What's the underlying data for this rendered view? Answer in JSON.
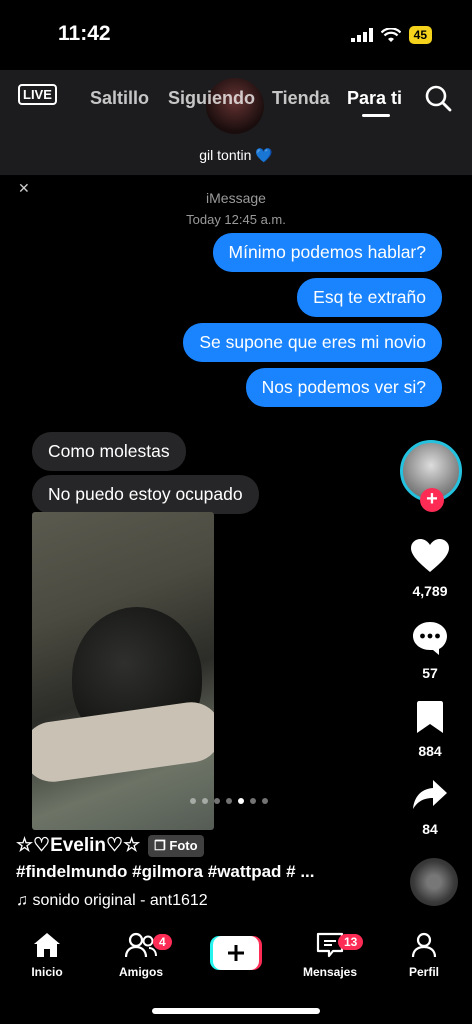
{
  "status": {
    "time": "11:42",
    "battery": "45"
  },
  "top_nav": {
    "live_label": "LIVE",
    "tabs": [
      {
        "label": "Saltillo"
      },
      {
        "label": "Siguiendo"
      },
      {
        "label": "Tienda"
      },
      {
        "label": "Para ti"
      }
    ]
  },
  "imessage": {
    "contact_name": "gil tontin 💙",
    "service_label": "iMessage",
    "timestamp": "Today 12:45 a.m.",
    "outgoing": [
      "Mínimo podemos hablar?",
      "Esq te extraño",
      "Se supone que eres mi novio",
      "Nos podemos ver si?"
    ],
    "incoming": [
      "Como molestas",
      "No puedo estoy ocupado"
    ]
  },
  "carousel": {
    "total": 7,
    "active_index": 5
  },
  "actions": {
    "likes": "4,789",
    "comments": "57",
    "saves": "884",
    "shares": "84"
  },
  "caption": {
    "username": "☆♡Evelin♡☆",
    "badge": "Foto",
    "hashtags": "#findelmundo #gilmora #wattpad # ...",
    "sound": "sonido original - ant1612"
  },
  "bottom_nav": {
    "items": [
      {
        "label": "Inicio"
      },
      {
        "label": "Amigos",
        "badge": "4"
      },
      {
        "label": "Mensajes",
        "badge": "13"
      },
      {
        "label": "Perfil"
      }
    ]
  },
  "colors": {
    "accent": "#fe2c55",
    "imessage_blue": "#1a84ff",
    "ring": "#25c2e0"
  }
}
